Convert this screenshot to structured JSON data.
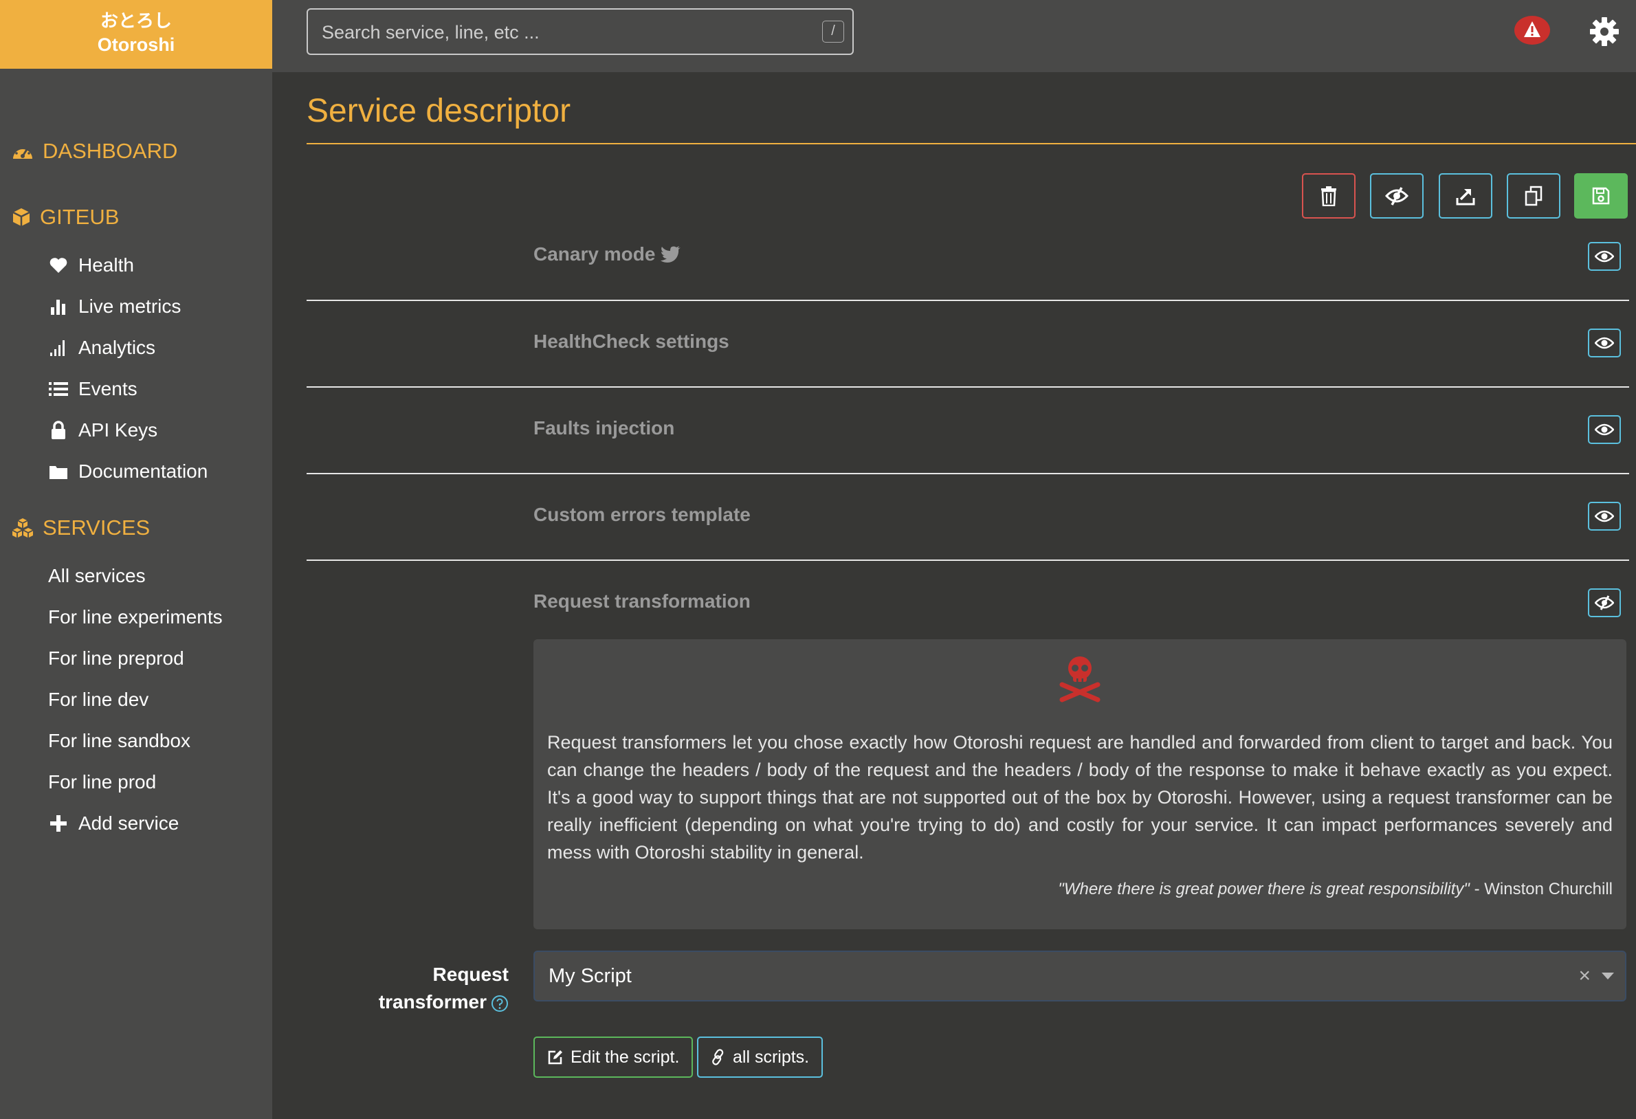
{
  "brand": {
    "jp": "おとろし",
    "name": "Otoroshi"
  },
  "search": {
    "placeholder": "Search service, line, etc ...",
    "shortcut": "/"
  },
  "sidebar": {
    "dashboard": "DASHBOARD",
    "service_name": "GITEUB",
    "service_items": [
      {
        "label": "Health",
        "icon": "heart-icon"
      },
      {
        "label": "Live metrics",
        "icon": "bar-chart-icon"
      },
      {
        "label": "Analytics",
        "icon": "signal-icon"
      },
      {
        "label": "Events",
        "icon": "list-icon"
      },
      {
        "label": "API Keys",
        "icon": "lock-icon"
      },
      {
        "label": "Documentation",
        "icon": "folder-icon"
      }
    ],
    "services_title": "SERVICES",
    "services_links": [
      "All services",
      "For line experiments",
      "For line preprod",
      "For line dev",
      "For line sandbox",
      "For line prod"
    ],
    "add_service": "Add service"
  },
  "page": {
    "title": "Service descriptor"
  },
  "panels": [
    {
      "title": "Canary mode"
    },
    {
      "title": "HealthCheck settings"
    },
    {
      "title": "Faults injection"
    },
    {
      "title": "Custom errors template"
    },
    {
      "title": "Request transformation"
    }
  ],
  "warning": {
    "text": "Request transformers let you chose exactly how Otoroshi request are handled and forwarded from client to target and back. You can change the headers / body of the request and the headers / body of the response to make it behave exactly as you expect. It's a good way to support things that are not supported out of the box by Otoroshi. However, using a request transformer can be really inefficient (depending on what you're trying to do) and costly for your service. It can impact performances severely and mess with Otoroshi stability in general.",
    "quote": "\"Where there is great power there is great responsibility\"",
    "quote_author": " - Winston Churchill"
  },
  "transformer": {
    "label_line1": "Request",
    "label_line2": "transformer",
    "value": "My Script",
    "clear": "×",
    "edit_label": "Edit the script.",
    "all_label": "all scripts."
  },
  "colors": {
    "accent": "#f0b040",
    "sidebar_bg": "#494948",
    "main_bg": "#373735",
    "danger": "#d9534f",
    "info": "#5bc0de",
    "success": "#5cb85c"
  }
}
